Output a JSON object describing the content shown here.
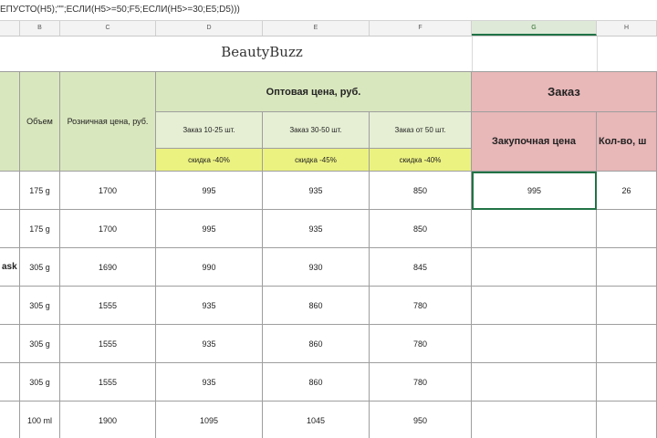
{
  "formula_bar": {
    "text": "ЕПУСТО(H5);\"\";ЕСЛИ(H5>=50;F5;ЕСЛИ(H5>=30;E5;D5)))"
  },
  "columns": [
    "B",
    "C",
    "D",
    "E",
    "F",
    "G",
    "H"
  ],
  "brand": "BeautyBuzz",
  "header": {
    "volume": "Объем",
    "retail_price": "Розничная цена, руб.",
    "wholesale_price": "Оптовая цена, руб.",
    "tiers": [
      {
        "label": "Заказ 10-25 шт.",
        "discount": "скидка -40%"
      },
      {
        "label": "Заказ 30-50 шт.",
        "discount": "скидка -45%"
      },
      {
        "label": "Заказ от 50 шт.",
        "discount": "скидка -40%"
      }
    ],
    "order": "Заказ",
    "purchase_price": "Закупочная цена",
    "quantity": "Кол-во, ш"
  },
  "rows": [
    {
      "name": "",
      "volume": "175 g",
      "retail": "1700",
      "p1": "995",
      "p2": "935",
      "p3": "850",
      "purchase": "995",
      "qty": "26"
    },
    {
      "name": "",
      "volume": "175 g",
      "retail": "1700",
      "p1": "995",
      "p2": "935",
      "p3": "850",
      "purchase": "",
      "qty": ""
    },
    {
      "name": "ask",
      "volume": "305 g",
      "retail": "1690",
      "p1": "990",
      "p2": "930",
      "p3": "845",
      "purchase": "",
      "qty": ""
    },
    {
      "name": "",
      "volume": "305 g",
      "retail": "1555",
      "p1": "935",
      "p2": "860",
      "p3": "780",
      "purchase": "",
      "qty": ""
    },
    {
      "name": "",
      "volume": "305 g",
      "retail": "1555",
      "p1": "935",
      "p2": "860",
      "p3": "780",
      "purchase": "",
      "qty": ""
    },
    {
      "name": "",
      "volume": "305 g",
      "retail": "1555",
      "p1": "935",
      "p2": "860",
      "p3": "780",
      "purchase": "",
      "qty": ""
    },
    {
      "name": "",
      "volume": "100 ml",
      "retail": "1900",
      "p1": "1095",
      "p2": "1045",
      "p3": "950",
      "purchase": "",
      "qty": ""
    }
  ]
}
